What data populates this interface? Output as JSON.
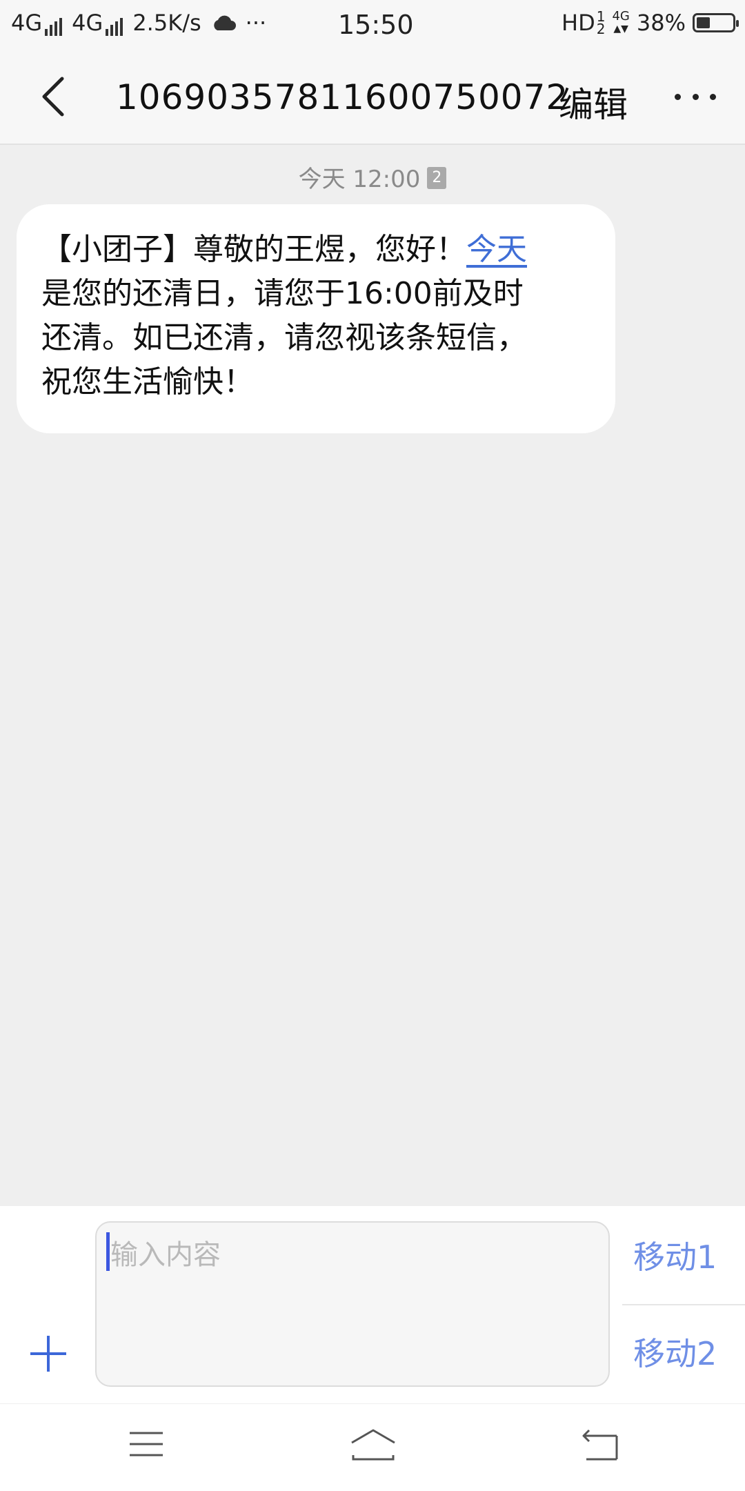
{
  "status_bar": {
    "sim1_network": "4G",
    "sim2_network": "4G",
    "speed": "2.5K/s",
    "weather_icon": "cloud-icon",
    "more": "···",
    "time": "15:50",
    "hd_label": "HD",
    "hd_sup": "1",
    "hd_sub": "2",
    "network_small": "4G",
    "battery_text": "38%",
    "battery_level": 0.38
  },
  "header": {
    "title": "1069035781160075​0072",
    "edit_label": "编辑"
  },
  "conversation": {
    "timestamp": "今天 12:00",
    "sim_badge": "2",
    "message": {
      "line1_prefix": "【小团子】尊敬的王煜，您好！",
      "line1_link": "今天",
      "line2": "是您的还清日，请您于16:00前及时",
      "line3": "还清。如已还清，请忽视该条短信，",
      "line4": "祝您生活愉快！"
    }
  },
  "compose": {
    "placeholder": "输入内容",
    "send_sim1": "移动1",
    "send_sim2": "移动2"
  },
  "colors": {
    "accent": "#3f6ed6",
    "send": "#6f8fe6",
    "background": "#efefef"
  }
}
